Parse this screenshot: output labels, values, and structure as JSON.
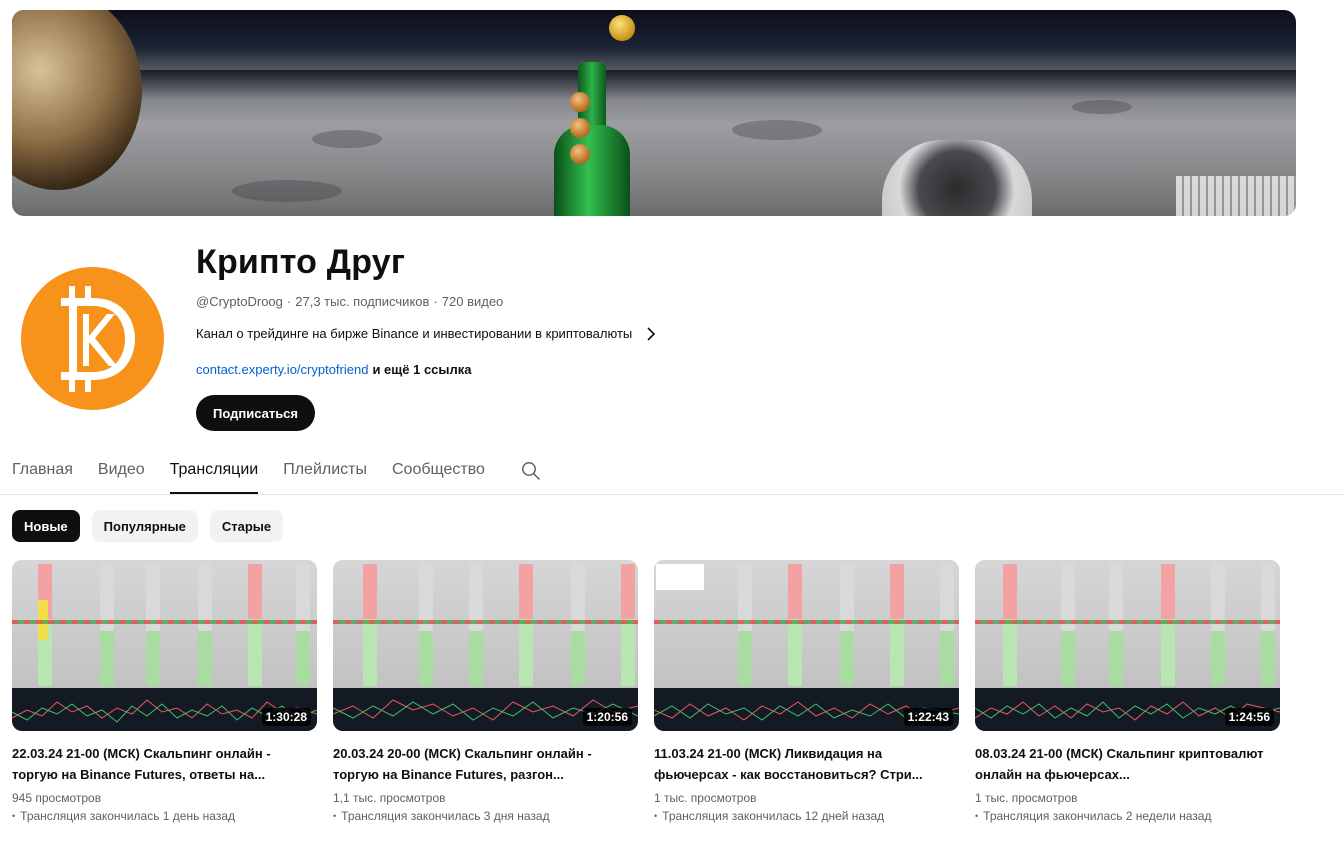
{
  "channel": {
    "name": "Крипто Друг",
    "handle": "@CryptoDroog",
    "subscribers": "27,3 тыс. подписчиков",
    "video_count": "720 видео",
    "separator": "·",
    "description": "Канал о трейдинге на бирже Binance и инвестировании в криптовалюты",
    "link_text": "contact.experty.io/cryptofriend",
    "more_links": "и ещё 1 ссылка",
    "subscribe_label": "Подписаться",
    "accent_color": "#f7931a"
  },
  "tabs": [
    {
      "label": "Главная",
      "active": false
    },
    {
      "label": "Видео",
      "active": false
    },
    {
      "label": "Трансляции",
      "active": true
    },
    {
      "label": "Плейлисты",
      "active": false
    },
    {
      "label": "Сообщество",
      "active": false
    }
  ],
  "filters": [
    {
      "label": "Новые",
      "active": true
    },
    {
      "label": "Популярные",
      "active": false
    },
    {
      "label": "Старые",
      "active": false
    }
  ],
  "videos": [
    {
      "title": "22.03.24 21-00 (МСК) Скальпинг онлайн - торгую на Binance Futures, ответы на...",
      "duration": "1:30:28",
      "views": "945 просмотров",
      "status": "Трансляция закончилась 1 день назад"
    },
    {
      "title": "20.03.24 20-00 (МСК) Скальпинг онлайн - торгую на Binance Futures, разгон...",
      "duration": "1:20:56",
      "views": "1,1 тыс. просмотров",
      "status": "Трансляция закончилась 3 дня назад"
    },
    {
      "title": "11.03.24 21-00 (МСК) Ликвидация на фьючерсах - как восстановиться? Стри...",
      "duration": "1:22:43",
      "views": "1 тыс. просмотров",
      "status": "Трансляция закончилась 12 дней назад"
    },
    {
      "title": "08.03.24 21-00 (МСК) Скальпинг криптовалют онлайн на фьючерсах...",
      "duration": "1:24:56",
      "views": "1 тыс. просмотров",
      "status": "Трансляция закончилась 2 недели назад"
    }
  ]
}
